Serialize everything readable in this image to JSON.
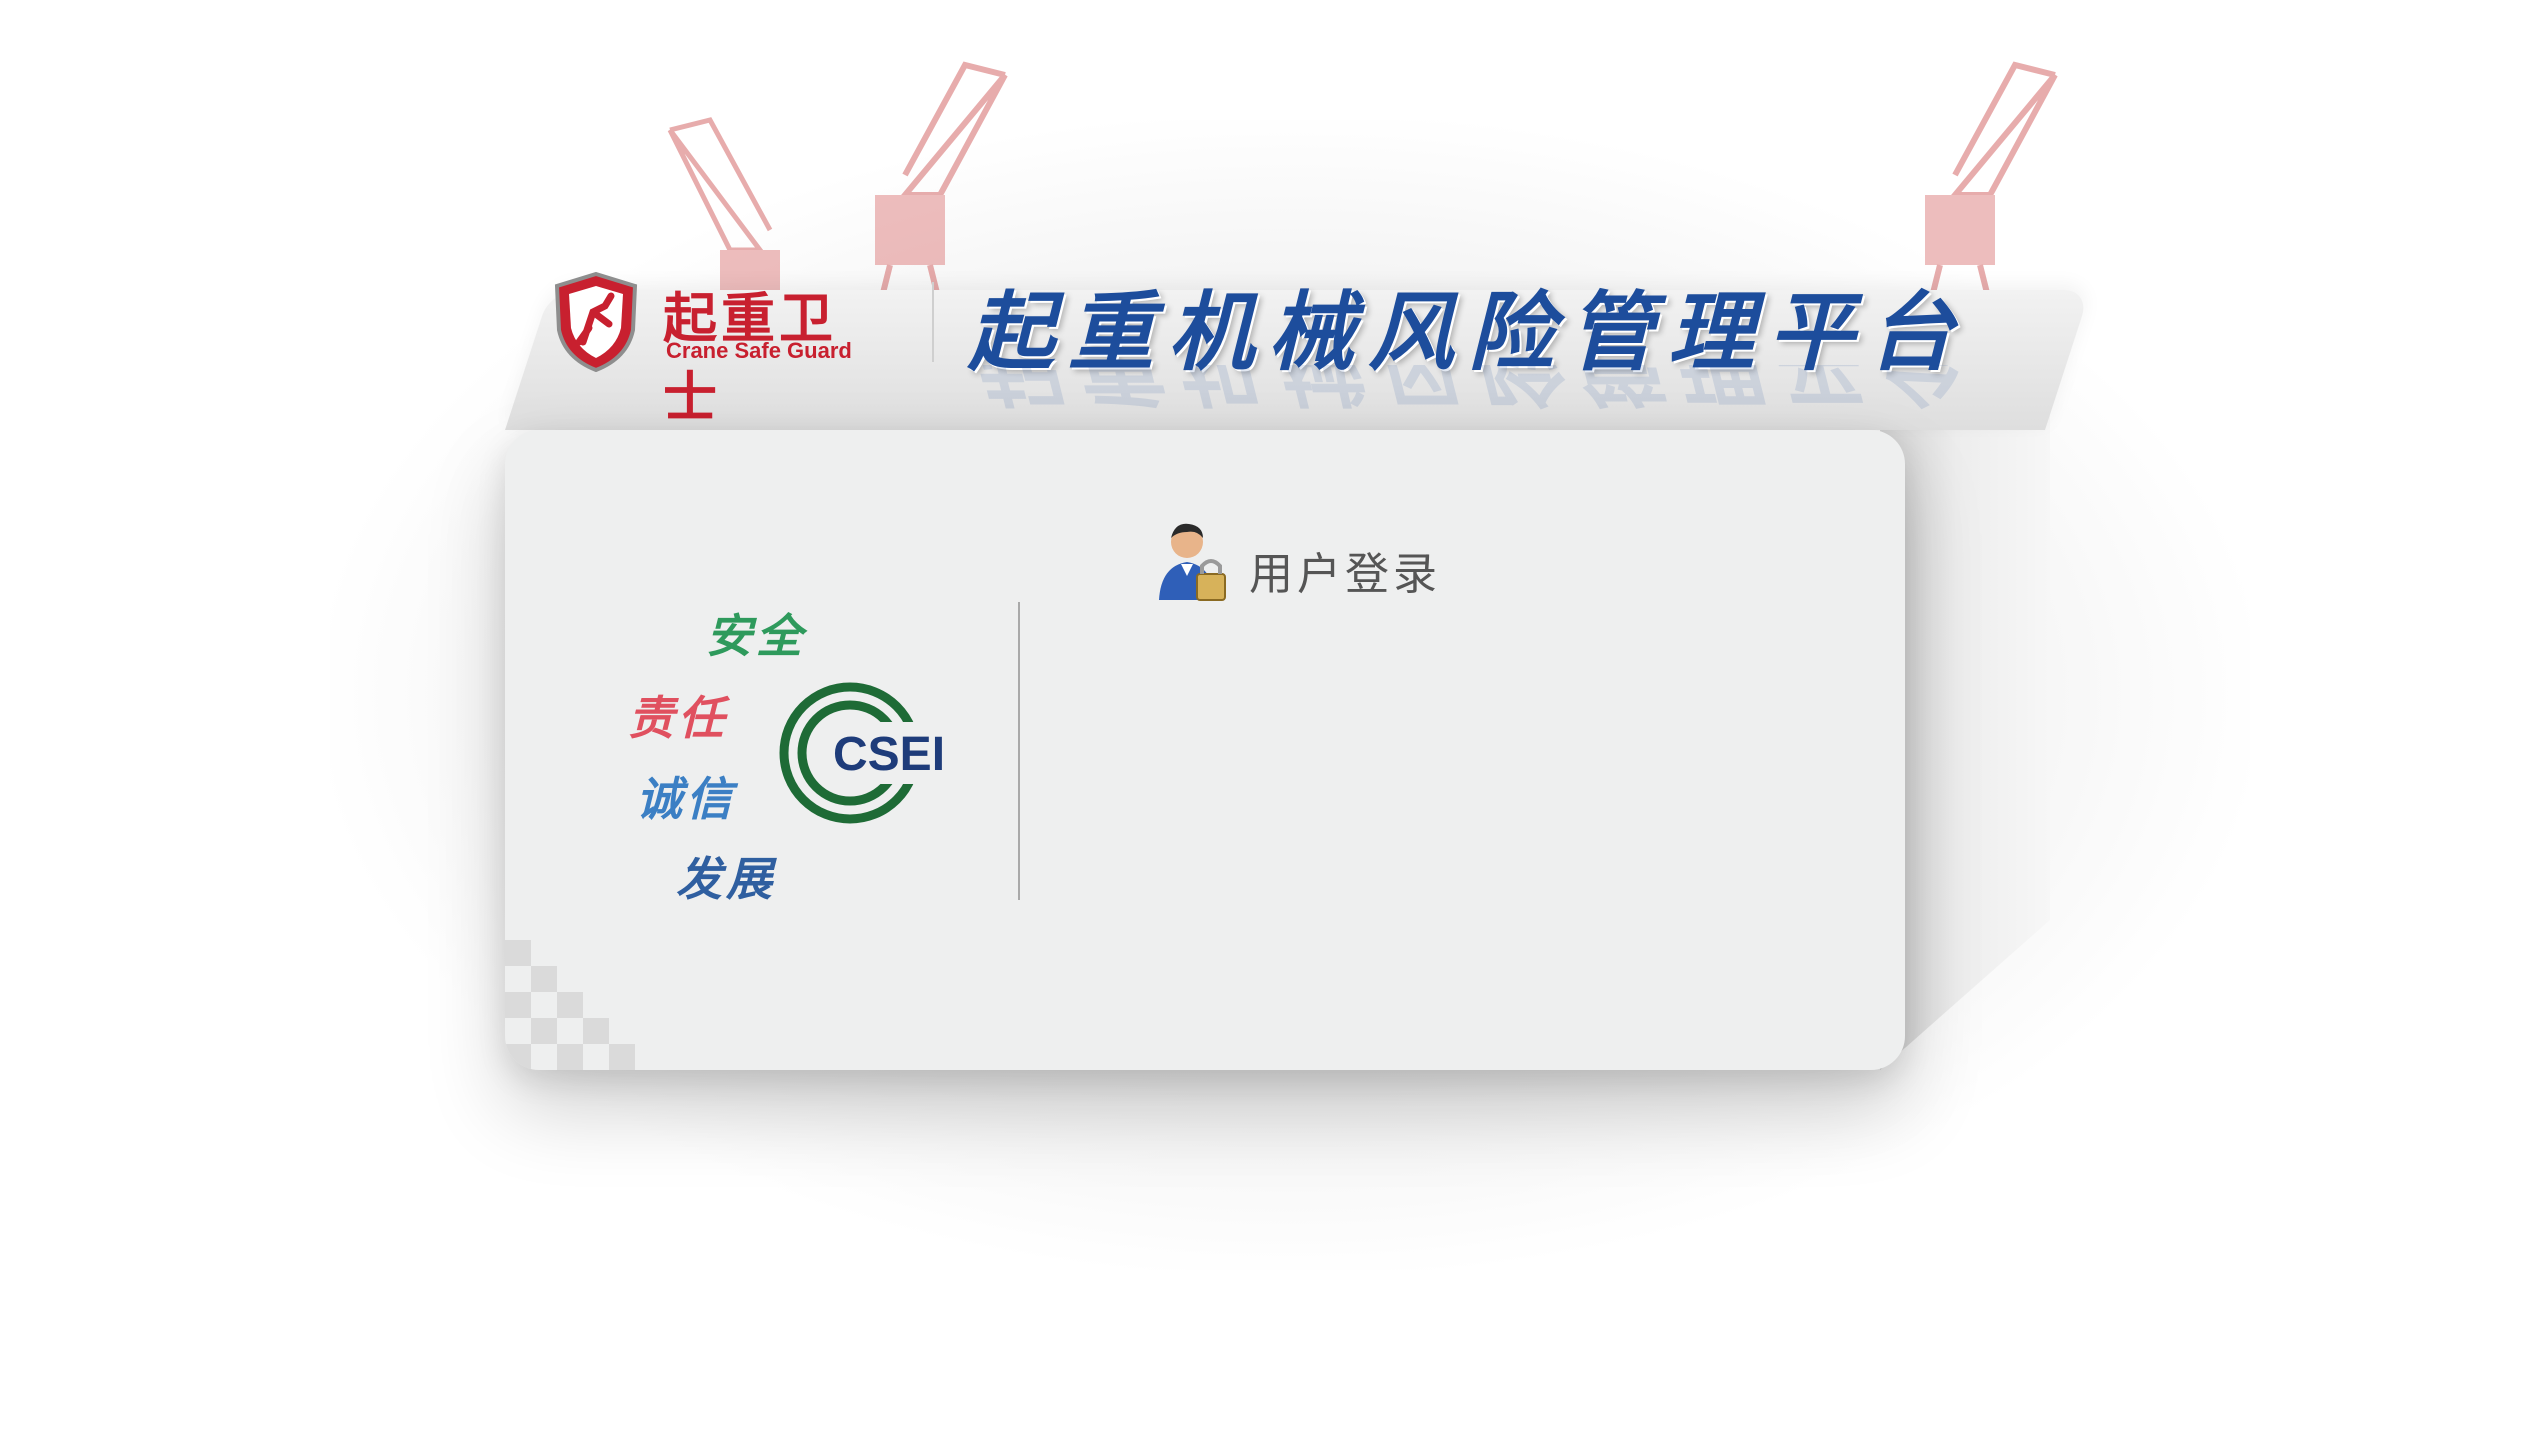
{
  "header": {
    "brand_name_cn": "起重卫士",
    "brand_name_en": "Crane Safe Guard",
    "platform_title": "起重机械风险管理平台"
  },
  "slogans": [
    {
      "text": "安全",
      "color": "#2e9a5c"
    },
    {
      "text": "责任",
      "color": "#e0505f"
    },
    {
      "text": "诚信",
      "color": "#3b7fc4"
    },
    {
      "text": "发展",
      "color": "#2f5fa0"
    }
  ],
  "csei_logo": {
    "text": "CSEI",
    "ring_color": "#1e6b36",
    "text_color": "#1e3c7a"
  },
  "login": {
    "title": "用户登录"
  },
  "colors": {
    "brand_red": "#c8202f",
    "title_blue": "#1d4d9c",
    "panel_bg": "#eeefef"
  },
  "icons": [
    "shield-logo-icon",
    "crane-icon",
    "user-lock-icon"
  ]
}
